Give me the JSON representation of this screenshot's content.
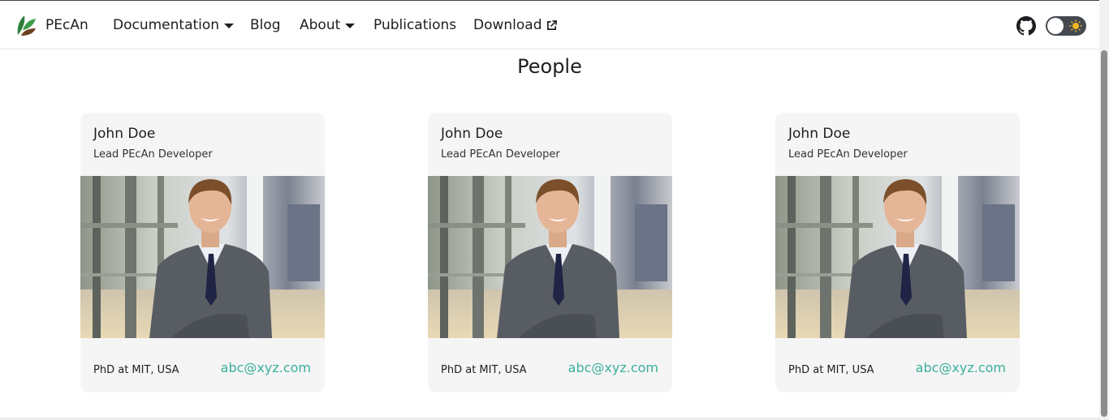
{
  "nav": {
    "brand": "PEcAn",
    "links": [
      {
        "label": "Documentation",
        "dropdown": true
      },
      {
        "label": "Blog",
        "dropdown": false
      },
      {
        "label": "About",
        "dropdown": true
      },
      {
        "label": "Publications",
        "dropdown": false
      },
      {
        "label": "Download",
        "external": true
      }
    ],
    "github_icon": "github-icon",
    "theme_toggle_icon": "sun-icon"
  },
  "page": {
    "title": "People"
  },
  "people": [
    {
      "name": "John Doe",
      "role": "Lead PEcAn Developer",
      "education": "PhD at MIT, USA",
      "email": "abc@xyz.com"
    },
    {
      "name": "John Doe",
      "role": "Lead PEcAn Developer",
      "education": "PhD at MIT, USA",
      "email": "abc@xyz.com"
    },
    {
      "name": "John Doe",
      "role": "Lead PEcAn Developer",
      "education": "PhD at MIT, USA",
      "email": "abc@xyz.com"
    }
  ],
  "colors": {
    "accent": "#3bb09a",
    "card_bg": "#f5f5f5",
    "toggle_bg": "#444950"
  }
}
